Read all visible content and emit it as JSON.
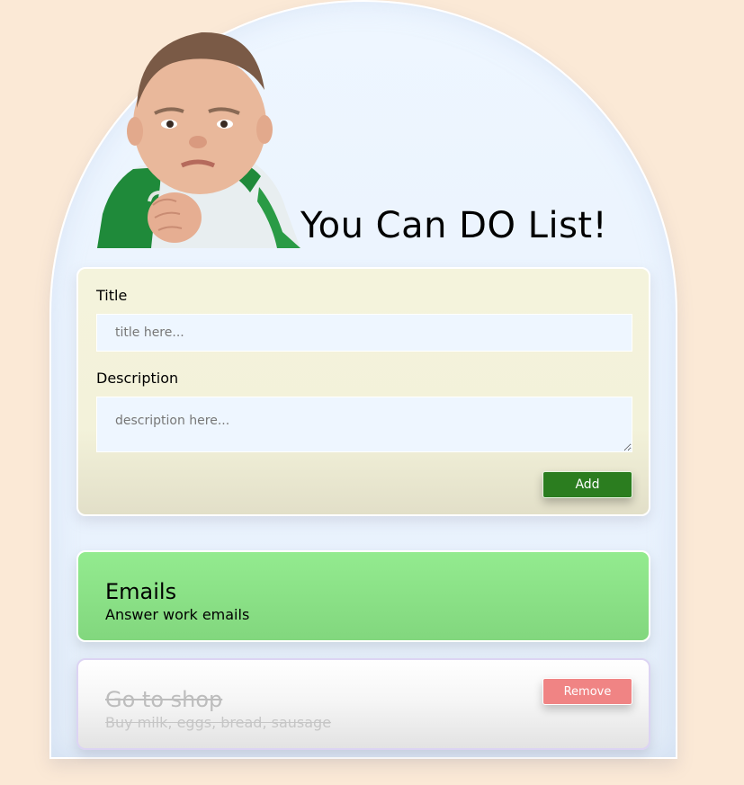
{
  "header": {
    "title": "You Can DO List!",
    "hero_image": "success-kid-fist-photo"
  },
  "form": {
    "title_label": "Title",
    "title_placeholder": "title here...",
    "title_value": "",
    "description_label": "Description",
    "description_placeholder": "description here...",
    "description_value": "",
    "add_label": "Add"
  },
  "todos": [
    {
      "title": "Emails",
      "description": "Answer work emails",
      "done": false,
      "background": "#93eb8f"
    },
    {
      "title": "Go to shop",
      "description": "Buy milk, eggs, bread, sausage",
      "done": true,
      "remove_label": "Remove",
      "background": "#f2f2f2"
    }
  ],
  "colors": {
    "page_background": "#fbe9d6",
    "add_button": "#2b7d1f",
    "remove_button": "#f08484",
    "form_card": "#f4f3dc"
  }
}
